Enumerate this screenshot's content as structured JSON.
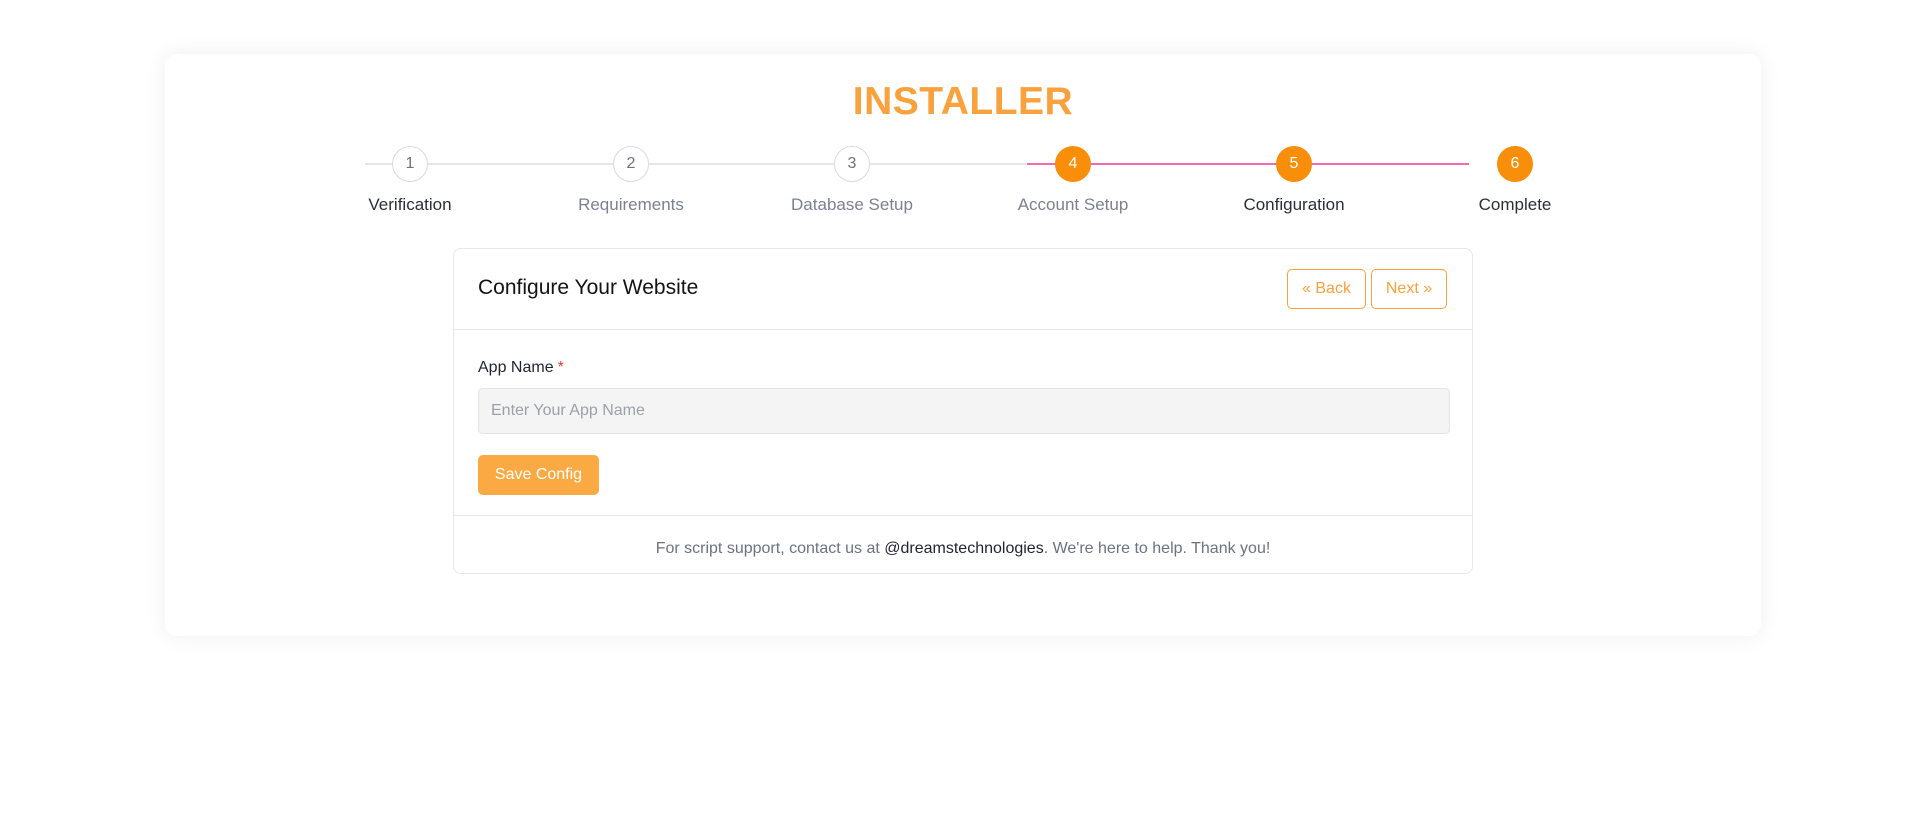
{
  "installer": {
    "title": "INSTALLER"
  },
  "steps": [
    {
      "number": "1",
      "label": "Verification",
      "active": false
    },
    {
      "number": "2",
      "label": "Requirements",
      "active": false
    },
    {
      "number": "3",
      "label": "Database Setup",
      "active": false
    },
    {
      "number": "4",
      "label": "Account Setup",
      "active": true
    },
    {
      "number": "5",
      "label": "Configuration",
      "active": true
    },
    {
      "number": "6",
      "label": "Complete",
      "active": true
    }
  ],
  "card": {
    "title": "Configure Your Website",
    "back_label": "« Back",
    "next_label": "Next »",
    "field_label": "App Name",
    "required_marker": "*",
    "input_value": "",
    "input_placeholder": "Enter Your App Name",
    "save_label": "Save Config"
  },
  "footer": {
    "text_before": "For script support, contact us at ",
    "link_text": "@dreamstechnologies",
    "text_after": ". We're here to help. Thank you!"
  },
  "colors": {
    "accent": "#f9a13c",
    "step_active": "#f98e0a",
    "line_active": "#f06bb3",
    "required": "#e53935"
  }
}
